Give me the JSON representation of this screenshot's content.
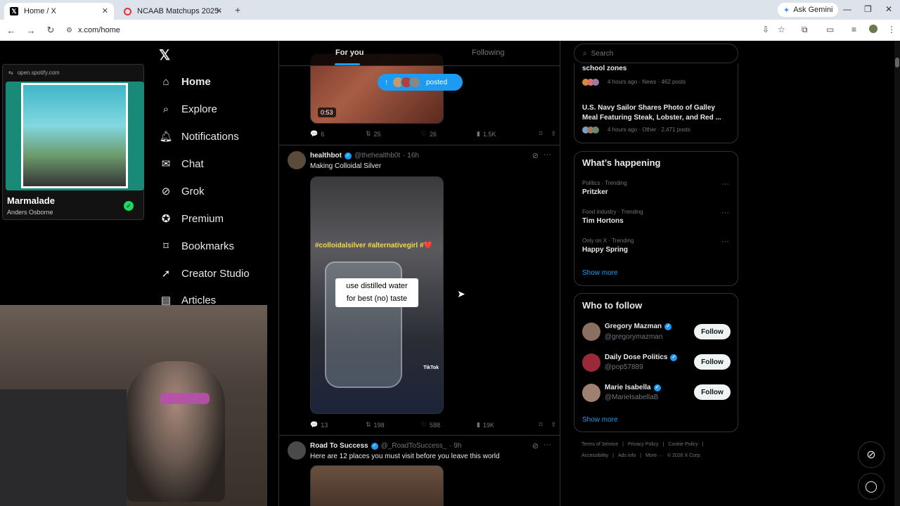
{
  "browser": {
    "tabs": [
      {
        "title": "Home / X",
        "favicon": "x-logo"
      },
      {
        "title": "NCAAB Matchups 2025-2026 -",
        "favicon": "red-c-logo"
      }
    ],
    "new_tab": "+",
    "gemini_label": "Ask Gemini",
    "url": "x.com/home"
  },
  "spotify": {
    "url": "open.spotify.com",
    "track": "Marmalade",
    "artist": "Anders Osborne",
    "accent": "#1ed760"
  },
  "x_nav": {
    "items": [
      {
        "label": "Home",
        "icon": "home-icon"
      },
      {
        "label": "Explore",
        "icon": "search-icon"
      },
      {
        "label": "Notifications",
        "icon": "bell-icon"
      },
      {
        "label": "Chat",
        "icon": "mail-icon"
      },
      {
        "label": "Grok",
        "icon": "grok-icon"
      },
      {
        "label": "Premium",
        "icon": "premium-icon"
      },
      {
        "label": "Bookmarks",
        "icon": "bookmark-icon"
      },
      {
        "label": "Creator Studio",
        "icon": "rocket-icon"
      },
      {
        "label": "Articles",
        "icon": "articles-icon"
      }
    ]
  },
  "feed": {
    "tabs": [
      "For you",
      "Following"
    ],
    "posted_pill": "posted",
    "post0": {
      "duration": "0:53",
      "replies": "6",
      "reposts": "25",
      "likes": "26",
      "views": "1.5K"
    },
    "post1": {
      "name": "healthbot",
      "handle": "@thehealthb0t",
      "time": "· 16h",
      "text": "Making Colloidal Silver",
      "overlay_hashtags": "#colloidalsilver #alternativegirl #❤️",
      "overlay_caption_1": "use distilled water",
      "overlay_caption_2": "for best (no) taste",
      "watermark": "TikTok",
      "replies": "13",
      "reposts": "198",
      "likes": "588",
      "views": "19K"
    },
    "post2": {
      "name": "Road To Success",
      "handle": "@_RoadToSuccess_",
      "time": "· 9h",
      "text": "Here are 12 places you must visit before you leave this world"
    }
  },
  "sidebar": {
    "search_placeholder": "Search",
    "news": [
      {
        "title": "school zones",
        "meta": "4 hours ago · News · 462 posts"
      },
      {
        "title": "U.S. Navy Sailor Shares Photo of Galley Meal Featuring Steak, Lobster, and Red ...",
        "meta": "4 hours ago · Other · 2,471 posts"
      }
    ],
    "happening": {
      "title": "What’s happening",
      "items": [
        {
          "context": "Politics · Trending",
          "topic": "Pritzker"
        },
        {
          "context": "Food industry · Trending",
          "topic": "Tim Hortons"
        },
        {
          "context": "Only on X · Trending",
          "topic": "Happy Spring"
        }
      ],
      "show_more": "Show more"
    },
    "who_to_follow": {
      "title": "Who to follow",
      "accounts": [
        {
          "name": "Gregory Mazman",
          "handle": "@gregorymazman"
        },
        {
          "name": "Daily Dose Politics",
          "handle": "@pop57889"
        },
        {
          "name": "Marie Isabella",
          "handle": "@MarieIsabellaB"
        }
      ],
      "follow_label": "Follow",
      "show_more": "Show more"
    },
    "footer": {
      "row1": [
        "Terms of Service",
        "Privacy Policy",
        "Cookie Policy"
      ],
      "row2": [
        "Accessibility",
        "Ads info",
        "More ···",
        "© 2026 X Corp."
      ]
    }
  },
  "colors": {
    "accent": "#1d9bf0",
    "bg": "#000000",
    "border": "#2f3336",
    "muted": "#71767b"
  }
}
